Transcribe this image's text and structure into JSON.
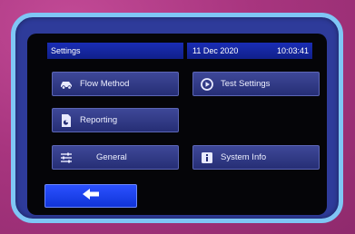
{
  "status": {
    "title": "Settings",
    "date": "11 Dec 2020",
    "time": "10:03:41"
  },
  "menu": {
    "flow_method": {
      "label": "Flow Method",
      "icon": "car-icon"
    },
    "test_settings": {
      "label": "Test Settings",
      "icon": "play-circle-icon"
    },
    "reporting": {
      "label": "Reporting",
      "icon": "report-icon"
    },
    "general": {
      "label": "General",
      "icon": "sliders-icon"
    },
    "system_info": {
      "label": "System Info",
      "icon": "info-icon"
    }
  },
  "back": {
    "icon": "arrow-left-icon"
  }
}
